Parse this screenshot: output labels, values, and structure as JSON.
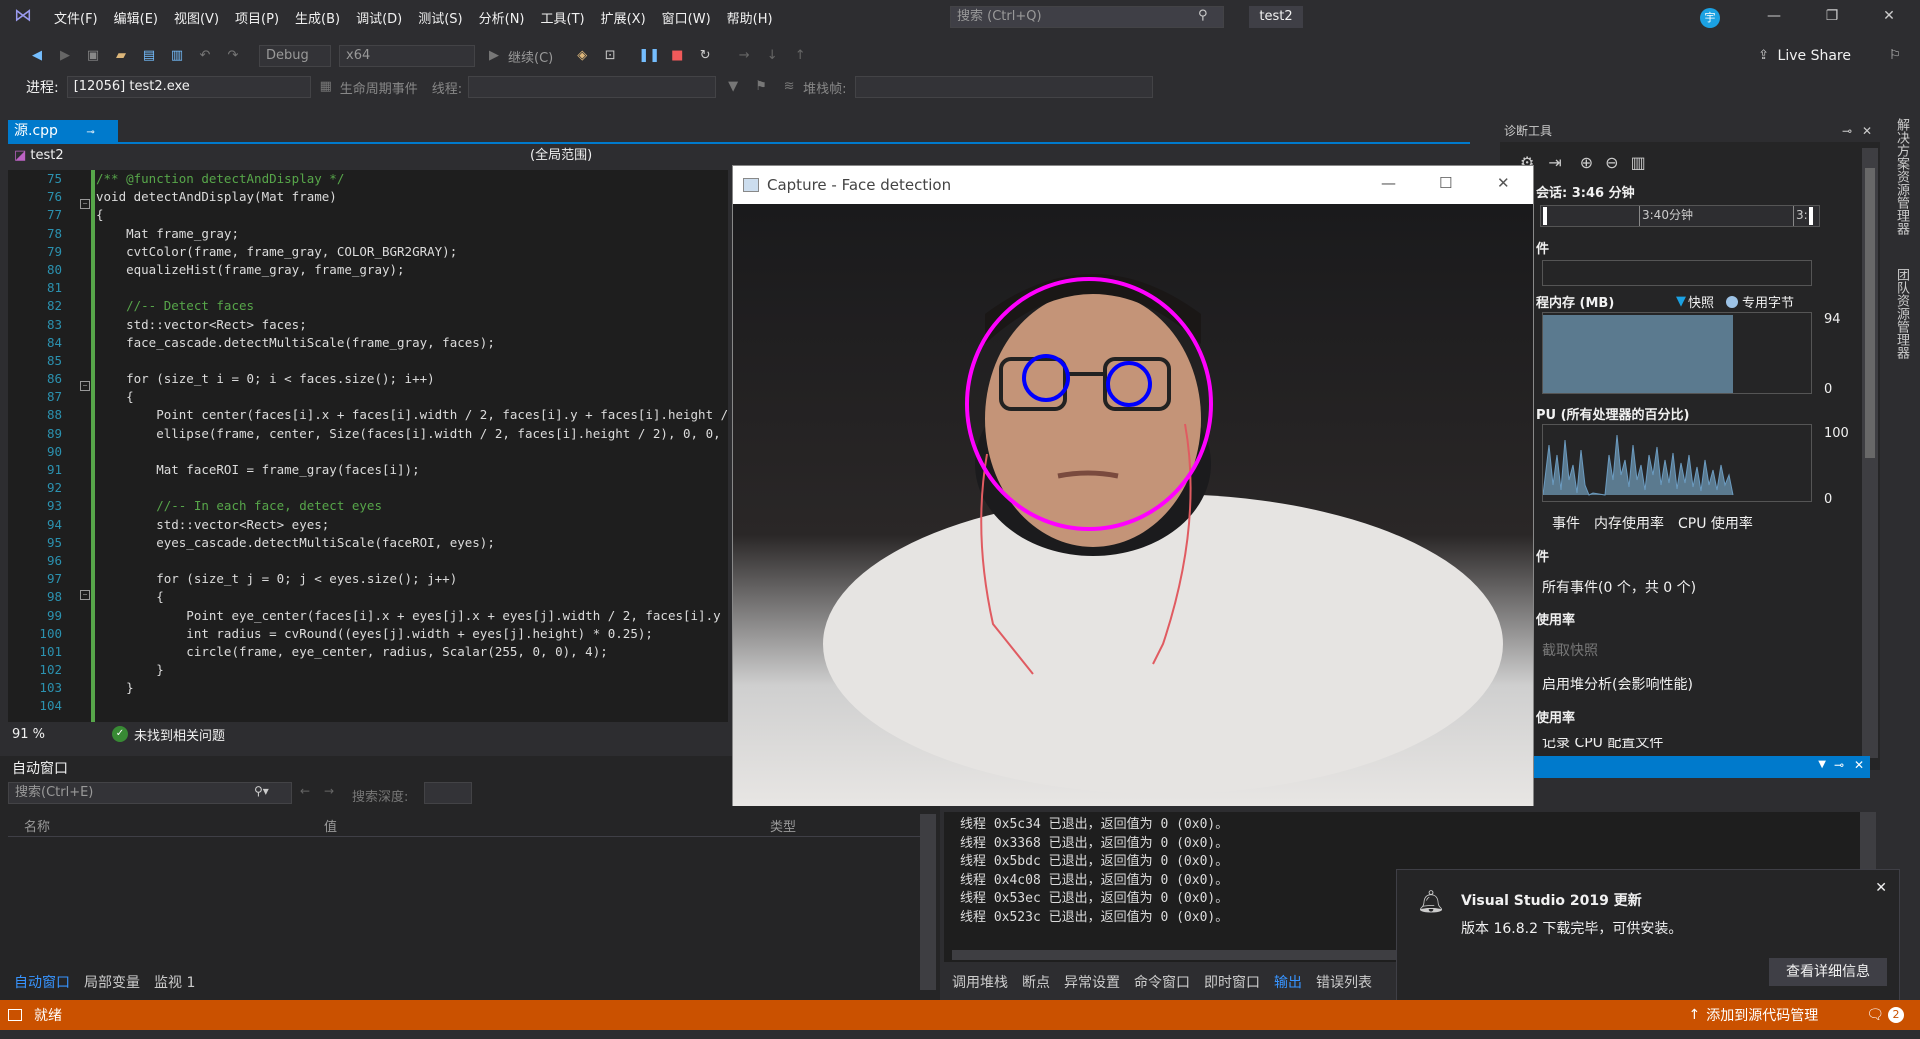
{
  "title_bar": {
    "menus": [
      "文件(F)",
      "编辑(E)",
      "视图(V)",
      "项目(P)",
      "生成(B)",
      "调试(D)",
      "测试(S)",
      "分析(N)",
      "工具(T)",
      "扩展(X)",
      "窗口(W)",
      "帮助(H)"
    ],
    "search_placeholder": "搜索 (Ctrl+Q)",
    "project_name": "test2",
    "avatar_letter": "宇",
    "live_share": "Live Share"
  },
  "toolbar": {
    "config": "Debug",
    "platform": "x64",
    "continue_label": "继续(C)",
    "process_label": "进程:",
    "process_value": "[12056] test2.exe",
    "lifecycle_label": "生命周期事件",
    "thread_label": "线程:",
    "stack_label": "堆栈帧:"
  },
  "editor": {
    "tab_label": "源.cpp",
    "project_combo": "test2",
    "scope_combo": "(全局范围)",
    "line_numbers": [
      "75",
      "76",
      "77",
      "78",
      "79",
      "80",
      "81",
      "82",
      "83",
      "84",
      "85",
      "86",
      "87",
      "88",
      "89",
      "90",
      "91",
      "92",
      "93",
      "94",
      "95",
      "96",
      "97",
      "98",
      "99",
      "100",
      "101",
      "102",
      "103",
      "104"
    ],
    "lines": [
      "/** @function detectAndDisplay */",
      "void detectAndDisplay(Mat frame)",
      "{",
      "    Mat frame_gray;",
      "    cvtColor(frame, frame_gray, COLOR_BGR2GRAY);",
      "    equalizeHist(frame_gray, frame_gray);",
      "",
      "    //-- Detect faces",
      "    std::vector<Rect> faces;",
      "    face_cascade.detectMultiScale(frame_gray, faces);",
      "",
      "    for (size_t i = 0; i < faces.size(); i++)",
      "    {",
      "        Point center(faces[i].x + faces[i].width / 2, faces[i].y + faces[i].height /",
      "        ellipse(frame, center, Size(faces[i].width / 2, faces[i].height / 2), 0, 0,",
      "",
      "        Mat faceROI = frame_gray(faces[i]);",
      "",
      "        //-- In each face, detect eyes",
      "        std::vector<Rect> eyes;",
      "        eyes_cascade.detectMultiScale(faceROI, eyes);",
      "",
      "        for (size_t j = 0; j < eyes.size(); j++)",
      "        {",
      "            Point eye_center(faces[i].x + eyes[j].x + eyes[j].width / 2, faces[i].y",
      "            int radius = cvRound((eyes[j].width + eyes[j].height) * 0.25);",
      "            circle(frame, eye_center, radius, Scalar(255, 0, 0), 4);",
      "        }",
      "    }",
      ""
    ],
    "zoom": "91 %",
    "issues": "未找到相关问题"
  },
  "capture_window": {
    "title": "Capture - Face detection"
  },
  "diagnostics": {
    "title": "诊断工具",
    "session": "会话: 3:46 分钟",
    "timeline_label": "3:40分钟",
    "timeline_label2": "3:",
    "events_header": "件",
    "memory_header": "程内存 (MB)",
    "legend_snapshot": "快照",
    "legend_private": "专用字节",
    "mem_max": "94",
    "mem_min": "0",
    "cpu_header": "PU (所有处理器的百分比)",
    "cpu_max": "100",
    "cpu_min": "0",
    "tabs": [
      "事件",
      "内存使用率",
      "CPU 使用率"
    ],
    "events_section": "件",
    "all_events": "所有事件(0 个，共 0 个)",
    "mem_section": "使用率",
    "snapshot_btn": "截取快照",
    "heap_btn": "启用堆分析(会影响性能)",
    "cpu_section": "使用率",
    "cpu_cut": "记录 CPU 配置文件"
  },
  "right_rail": {
    "label1": "解决方案资源管理器",
    "label2": "团队资源管理器"
  },
  "autos": {
    "title": "自动窗口",
    "search_placeholder": "搜索(Ctrl+E)",
    "depth_label": "搜索深度:",
    "col_name": "名称",
    "col_value": "值",
    "col_type": "类型",
    "tabs": [
      "自动窗口",
      "局部变量",
      "监视 1"
    ]
  },
  "output": {
    "lines": [
      "线程 0x5c34 已退出，返回值为 0 (0x0)。",
      "线程 0x3368 已退出，返回值为 0 (0x0)。",
      "线程 0x5bdc 已退出，返回值为 0 (0x0)。",
      "线程 0x4c08 已退出，返回值为 0 (0x0)。",
      "线程 0x53ec 已退出，返回值为 0 (0x0)。",
      "线程 0x523c 已退出，返回值为 0 (0x0)。"
    ],
    "tabs": [
      "调用堆栈",
      "断点",
      "异常设置",
      "命令窗口",
      "即时窗口",
      "输出",
      "错误列表"
    ]
  },
  "notification": {
    "title": "Visual Studio 2019 更新",
    "body": "版本 16.8.2 下载完毕，可供安装。",
    "button": "查看详细信息"
  },
  "status_bar": {
    "ready": "就绪",
    "source_control": "添加到源代码管理",
    "badge": "2"
  },
  "colors": {
    "accent": "#007acc",
    "status": "#ca5100",
    "face_ellipse": "#ff00ff",
    "eye_circle": "#0000ff"
  }
}
